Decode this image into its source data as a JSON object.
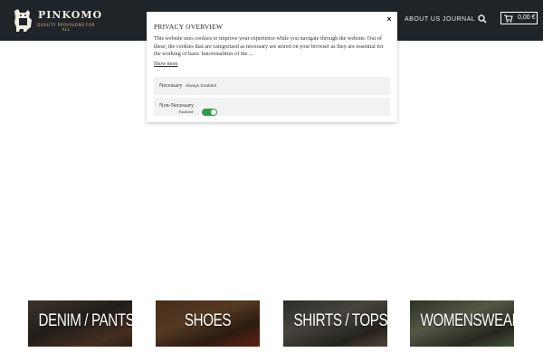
{
  "header": {
    "logo": {
      "name": "PINKOMO",
      "tagline": "QUALITY PROVISIONS FOR ALL"
    },
    "nav": [
      {
        "label": "ABOUT US"
      },
      {
        "label": "JOURNAL"
      }
    ],
    "search_icon": "search-icon",
    "cart": {
      "icon": "cart-icon",
      "total": "0,00 €"
    }
  },
  "privacy_modal": {
    "title": "PRIVACY OVERVIEW",
    "close_label": "×",
    "text": "This website uses cookies to improve your experience while you navigate through the website. Out of these, the cookies that are categorized as necessary are stored on your browser as they are essential for the working of basic functionalities of the ...",
    "show_more": "Show more",
    "rows": [
      {
        "label": "Necessary",
        "status": "Always Enabled"
      },
      {
        "label": "Non-Necessary",
        "toggle_label": "Enabled",
        "toggle_on": true
      }
    ],
    "toggle_color": "#2e9c4a"
  },
  "categories": [
    {
      "label": "DENIM / PANTS"
    },
    {
      "label": "SHOES"
    },
    {
      "label": "SHIRTS / TOPS"
    },
    {
      "label": "WOMENSWEAR"
    }
  ],
  "colors": {
    "header_bg": "#1f2428",
    "accent_gold": "#d7c08a"
  }
}
